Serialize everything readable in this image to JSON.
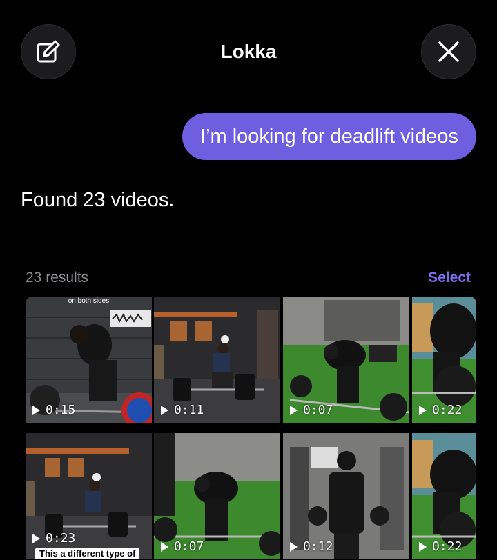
{
  "header": {
    "title": "Lokka",
    "compose_icon": "compose-icon",
    "close_icon": "close-icon"
  },
  "chat": {
    "user_message": "I’m looking for deadlift videos",
    "assistant_message": "Found 23 videos."
  },
  "results": {
    "count_label": "23 results",
    "select_label": "Select"
  },
  "videos": [
    {
      "duration": "0:15",
      "caption_top": "on both sides"
    },
    {
      "duration": "0:11"
    },
    {
      "duration": "0:07"
    },
    {
      "duration": "0:22"
    },
    {
      "duration": "0:23",
      "caption_bottom": "This a different type of"
    },
    {
      "duration": "0:07"
    },
    {
      "duration": "0:12"
    },
    {
      "duration": "0:22"
    }
  ],
  "colors": {
    "background": "#000000",
    "bubble": "#6e5fe0",
    "accent": "#7d6df0",
    "muted": "#8e8e93"
  }
}
